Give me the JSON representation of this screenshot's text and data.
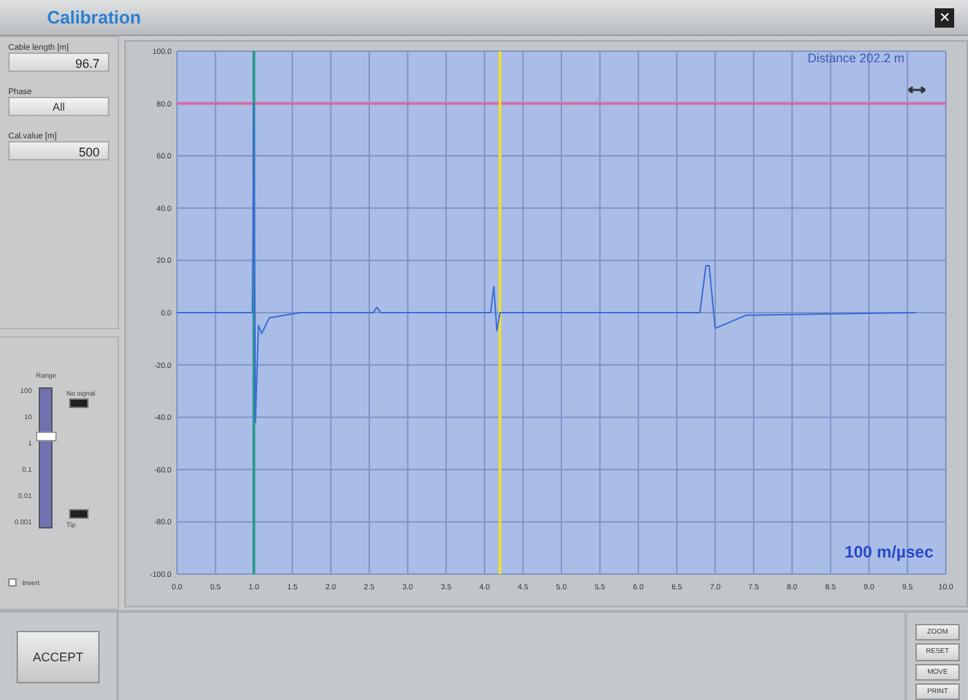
{
  "window": {
    "title": "Calibration",
    "close": "✕"
  },
  "settings": [
    {
      "label": "Cable length [m]",
      "kind": "field",
      "value": "96.7"
    },
    {
      "label": "Phase",
      "kind": "dropdown",
      "value": "All"
    },
    {
      "label": "Cal.value [m]",
      "kind": "field",
      "value": "500"
    }
  ],
  "gain": {
    "label": "Range",
    "scale": [
      "100",
      "10",
      "1",
      "0.1",
      "0.01",
      "0.001"
    ],
    "level": 0.65,
    "indicators": [
      "No signal",
      "Tip"
    ],
    "invert": {
      "label": "Invert",
      "checked": false
    }
  },
  "plot": {
    "readout": "Distance 202.2 m",
    "speed": "100 m/µsec",
    "chart_data": {
      "type": "line",
      "xlim": [
        0,
        10
      ],
      "ylim": [
        -100,
        100
      ],
      "x": [
        0,
        0.98,
        1.0,
        1.02,
        1.06,
        1.1,
        1.2,
        1.6,
        2.55,
        2.6,
        2.65,
        4.08,
        4.12,
        4.16,
        4.2,
        6.8,
        6.88,
        6.92,
        7.0,
        7.4,
        9.6
      ],
      "grid": true,
      "ref_lines": [
        {
          "axis": "y",
          "value": 80,
          "color": "#d86aa0"
        },
        {
          "axis": "x",
          "value": 1.0,
          "color": "#2a9a8a"
        },
        {
          "axis": "x",
          "value": 4.2,
          "color": "#f0e030"
        }
      ],
      "series": [
        {
          "color": "#3a6ad8",
          "values": [
            0,
            0,
            80,
            -42,
            -5,
            -8,
            -2,
            0,
            0,
            2,
            0,
            0,
            10,
            -7,
            0,
            0,
            18,
            18,
            -6,
            -1,
            0
          ]
        }
      ],
      "yticks": [
        {
          "value": 100,
          "label": "100.0"
        },
        {
          "value": 80,
          "label": "80.0"
        },
        {
          "value": 60,
          "label": "60.0"
        },
        {
          "value": 40,
          "label": "40.0"
        },
        {
          "value": 20,
          "label": "20.0"
        },
        {
          "value": 0,
          "label": "0.0"
        },
        {
          "value": -20,
          "label": "-20.0"
        },
        {
          "value": -40,
          "label": "-40.0"
        },
        {
          "value": -60,
          "label": "-60.0"
        },
        {
          "value": -80,
          "label": "-80.0"
        },
        {
          "value": -100,
          "label": "-100.0"
        }
      ],
      "xticks": [
        {
          "value": 0,
          "label": "0.0"
        },
        {
          "value": 0.5,
          "label": "0.5"
        },
        {
          "value": 1,
          "label": "1.0"
        },
        {
          "value": 1.5,
          "label": "1.5"
        },
        {
          "value": 2,
          "label": "2.0"
        },
        {
          "value": 2.5,
          "label": "2.5"
        },
        {
          "value": 3,
          "label": "3.0"
        },
        {
          "value": 3.5,
          "label": "3.5"
        },
        {
          "value": 4,
          "label": "4.0"
        },
        {
          "value": 4.5,
          "label": "4.5"
        },
        {
          "value": 5,
          "label": "5.0"
        },
        {
          "value": 5.5,
          "label": "5.5"
        },
        {
          "value": 6,
          "label": "6.0"
        },
        {
          "value": 6.5,
          "label": "6.5"
        },
        {
          "value": 7,
          "label": "7.0"
        },
        {
          "value": 7.5,
          "label": "7.5"
        },
        {
          "value": 8,
          "label": "8.0"
        },
        {
          "value": 8.5,
          "label": "8.5"
        },
        {
          "value": 9,
          "label": "9.0"
        },
        {
          "value": 9.5,
          "label": "9.5"
        },
        {
          "value": 10,
          "label": "10.0"
        }
      ]
    }
  },
  "buttons": {
    "accept": "ACCEPT",
    "side": [
      "ZOOM",
      "RESET",
      "MOVE",
      "PRINT"
    ]
  }
}
